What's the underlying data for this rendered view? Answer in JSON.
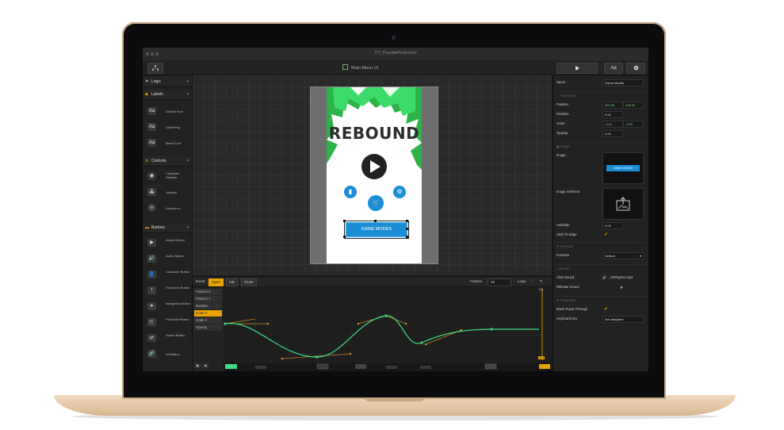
{
  "window": {
    "title": "TIT_PossiblePerfectInfo"
  },
  "toolbar": {
    "document_title": "Main Menu UI",
    "play_icon": "play-icon",
    "text_button_label": "Aa",
    "gear_icon": "gear-icon"
  },
  "left_panel": {
    "logic": {
      "label": "Logic"
    },
    "labels_section": {
      "label": "Labels",
      "items": [
        "Default Font",
        "GamePlay",
        "Menu Font"
      ]
    },
    "controls_section": {
      "label": "Controls",
      "items": [
        "Character Selector",
        "Joystick",
        "Acceleron..."
      ]
    },
    "buttons_section": {
      "label": "Buttons",
      "items": [
        "Action Button",
        "Audio Button",
        "Character Button",
        "Facebook Button",
        "Navigation Button",
        "Purchase Button",
        "Switch Button",
        "Url Button"
      ]
    }
  },
  "canvas": {
    "game_title": "REBOUND",
    "button_label": "GAME MODES"
  },
  "timeline": {
    "event_label": "Event",
    "tabs": [
      "Open",
      "Idle",
      "Close"
    ],
    "frames_label": "Frames",
    "frames_value": "35",
    "loop_label": "Loop",
    "properties": [
      "Position X",
      "Position Y",
      "Rotation",
      "Scale X",
      "Scale Y",
      "Opacity"
    ],
    "marker_top": "0.6",
    "marker_bottom": "-0.4"
  },
  "right_panel": {
    "name_label": "Name",
    "name_value": "Game Modes",
    "transform_header": "Transform",
    "position_label": "Position",
    "position_x": "320.00",
    "position_y": "226.00",
    "rotation_label": "Rotation",
    "rotation_value": "0.00",
    "scale_label": "Scale",
    "scale_x": "-0.01",
    "scale_y": "-0.01",
    "opacity_label": "Opacity",
    "opacity_value": "0.00",
    "image_header": "Image",
    "image_label": "Image",
    "image_thumb_text": "GAME MODES",
    "image_selected_label": "Image Selected",
    "autohide_label": "Autohide",
    "autohide_value": "0.00",
    "stick_label": "Stick To Edge",
    "function_header": "Function",
    "function_label": "Function",
    "function_value": "Default",
    "sound_header": "Sound",
    "click_sound_label": "Click Sound",
    "click_sound_value": "_000hg101.mp3",
    "release_sound_label": "Release Sound",
    "properties_header": "Properties",
    "block_touch_label": "Block Touch Through",
    "keyboard_key_label": "Keyboard Key",
    "keyboard_key_value": "Not assigned"
  },
  "colors": {
    "accent": "#e8a400",
    "blue": "#1a8fd6",
    "curve": "#3ddc84",
    "tangent": "#c98a2a"
  }
}
